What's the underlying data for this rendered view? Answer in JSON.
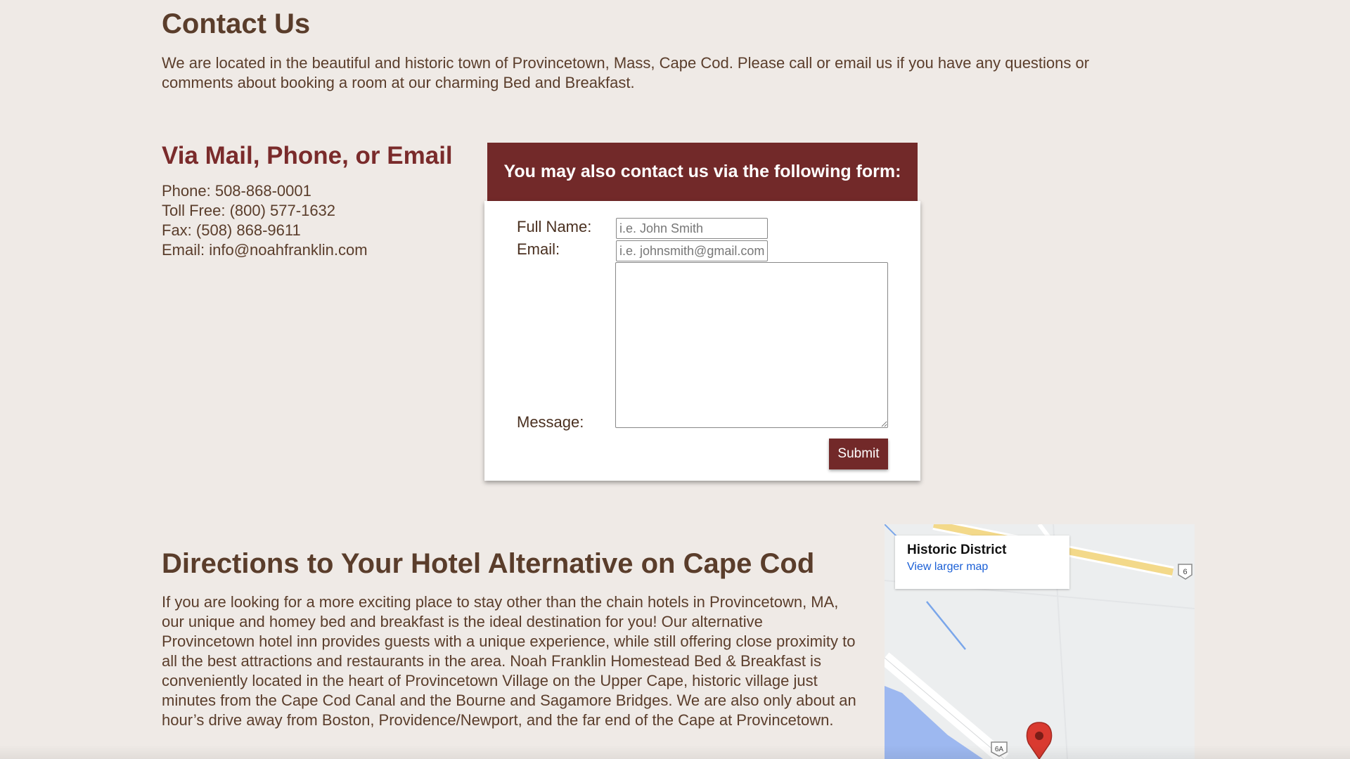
{
  "contact": {
    "title": "Contact Us",
    "intro": "We are located in the beautiful and historic town of Provincetown, Mass, Cape Cod. Please call or email us if you have any questions or comments about booking a room at our charming Bed and Breakfast."
  },
  "via": {
    "title": "Via Mail, Phone, or Email",
    "phone": "Phone: 508-868-0001",
    "toll_free": "Toll Free: (800) 577-1632",
    "fax": "Fax: (508) 868-9611",
    "email": "Email: info@noahfranklin.com"
  },
  "form": {
    "header": "You may also contact us via the following form:",
    "full_name_label": "Full Name:",
    "full_name_placeholder": "i.e. John Smith",
    "email_label": "Email:",
    "email_placeholder": "i.e. johnsmith@gmail.com",
    "message_label": "Message:",
    "submit_label": "Submit"
  },
  "directions": {
    "title": "Directions to Your Hotel Alternative on Cape Cod",
    "text": "If you are looking for a more exciting place to stay other than the chain hotels in Provincetown, MA, our unique and homey bed and breakfast is the ideal destination for you! Our alternative Provincetown hotel inn provides guests with a unique experience, while still offering close proximity to all the best attractions and restaurants in the area. Noah Franklin Homestead Bed & Breakfast is conveniently located in the heart of Provincetown Village on the Upper Cape, historic village just minutes from the Cape Cod Canal and the Bourne and Sagamore Bridges. We are also only about an hour’s drive away from Boston, Providence/Newport, and the far end of the Cape at Provincetown."
  },
  "map": {
    "place_name": "Historic District",
    "link_text": "View larger map",
    "route_6_label": "6",
    "route_6a_label": "6A",
    "colors": {
      "highway": "#f3d98a",
      "water": "#9db8f0",
      "road": "#ffffff",
      "pin": "#d93a30"
    }
  }
}
